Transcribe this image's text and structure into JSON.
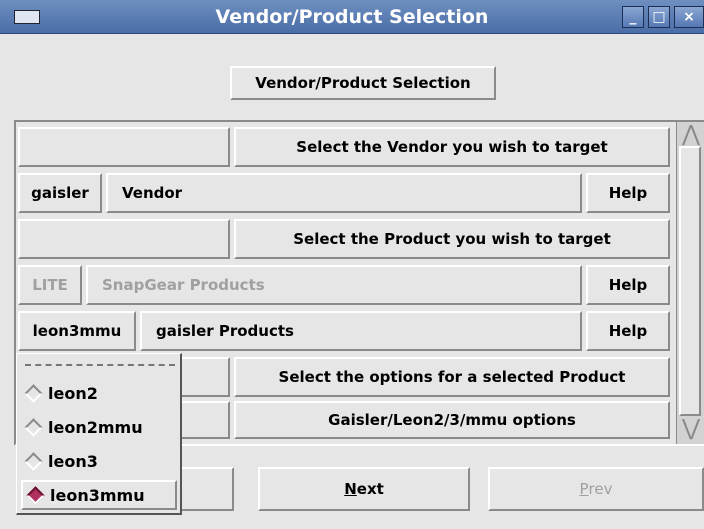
{
  "window": {
    "title": "Vendor/Product Selection",
    "minimize": "_",
    "maximize": "□",
    "close": "×"
  },
  "header_button": "Vendor/Product Selection",
  "rows": {
    "vendor_prompt": "Select the Vendor you wish to target",
    "vendor_value": "gaisler",
    "vendor_label": "Vendor",
    "product_prompt": "Select the Product you wish to target",
    "snapgear_value": "LITE",
    "snapgear_label": "SnapGear Products",
    "gaisler_value": "leon3mmu",
    "gaisler_label": "gaisler Products",
    "options_prompt": "Select the options for a selected Product",
    "options_label": "Gaisler/Leon2/3/mmu options",
    "help": "Help"
  },
  "popup": {
    "items": [
      {
        "label": "leon2",
        "selected": false
      },
      {
        "label": "leon2mmu",
        "selected": false
      },
      {
        "label": "leon3",
        "selected": false
      },
      {
        "label": "leon3mmu",
        "selected": true
      }
    ]
  },
  "nav": {
    "next_prefix": "N",
    "next_rest": "ext",
    "prev_prefix": "P",
    "prev_rest": "rev"
  },
  "scroll": {
    "up": "⋀",
    "down": "⋁"
  }
}
